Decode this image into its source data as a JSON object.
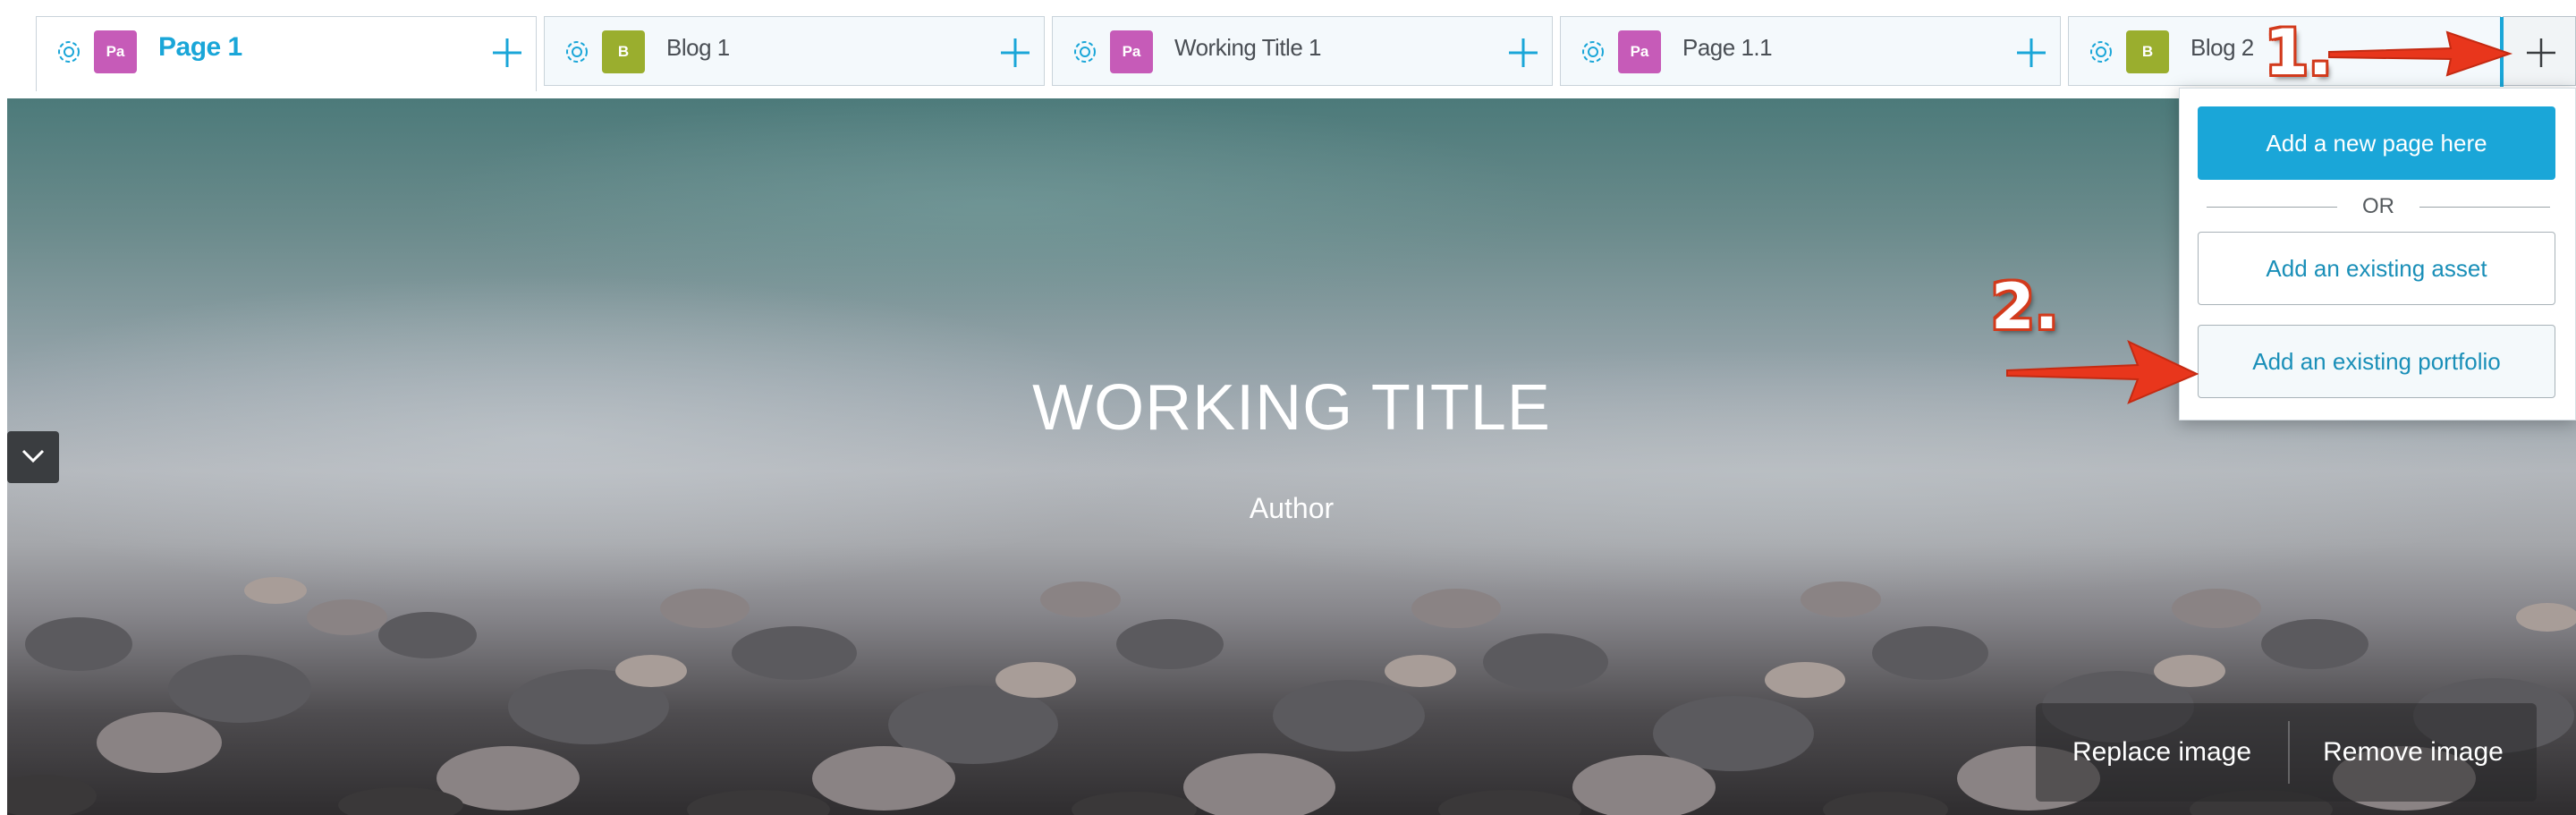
{
  "tabs": [
    {
      "badge": "Pa",
      "badge_color": "#c65bb8",
      "label": "Page 1",
      "active": true
    },
    {
      "badge": "B",
      "badge_color": "#9aae2e",
      "label": "Blog 1",
      "active": false
    },
    {
      "badge": "Pa",
      "badge_color": "#c65bb8",
      "label": "Working Title 1",
      "active": false
    },
    {
      "badge": "Pa",
      "badge_color": "#c65bb8",
      "label": "Page 1.1",
      "active": false
    },
    {
      "badge": "B",
      "badge_color": "#9aae2e",
      "label": "Blog 2",
      "active": false
    }
  ],
  "icons": {
    "tab_settings": "gear-icon",
    "tab_add": "plus-icon",
    "add_tab": "plus-icon",
    "collapse": "chevron-down-icon"
  },
  "hero": {
    "title": "WORKING TITLE",
    "author": "Author"
  },
  "image_actions": {
    "replace_label": "Replace image",
    "remove_label": "Remove image"
  },
  "dropdown": {
    "add_new_page": "Add a new page here",
    "or": "OR",
    "add_existing_asset": "Add an existing asset",
    "add_existing_portfolio": "Add an existing portfolio"
  },
  "annotations": {
    "step1": "1.",
    "step2": "2."
  },
  "colors": {
    "accent": "#1aa6d8",
    "annotation_red": "#e8361c",
    "page_badge": "#c65bb8",
    "blog_badge": "#9aae2e"
  }
}
